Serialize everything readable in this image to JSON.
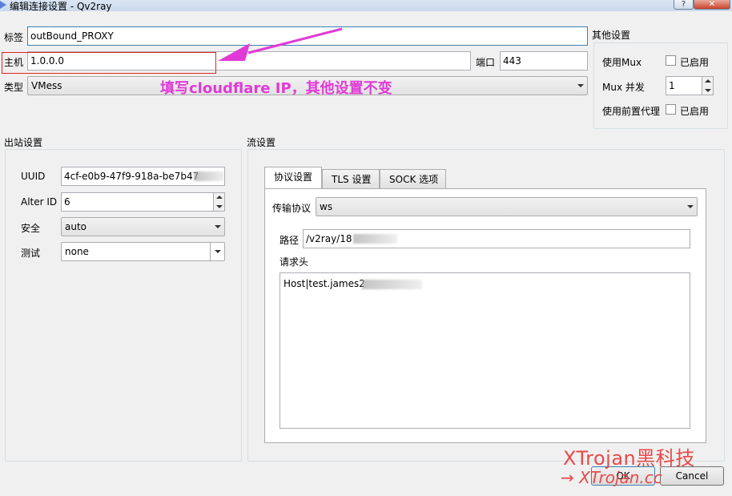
{
  "window": {
    "title": "编辑连接设置 - Qv2ray",
    "help_label": "?",
    "close_label": "✕"
  },
  "top": {
    "tag_label": "标签",
    "tag_value": "outBound_PROXY",
    "host_label": "主机",
    "host_value": "1.0.0.0",
    "port_label": "端口",
    "port_value": "443",
    "type_label": "类型",
    "type_value": "VMess"
  },
  "other_settings": {
    "title": "其他设置",
    "mux_label": "使用Mux",
    "mux_check_label": "已启用",
    "mux_concurrency_label": "Mux 并发",
    "mux_concurrency_value": "1",
    "proxy_label": "使用前置代理",
    "proxy_check_label": "已启用"
  },
  "outbound": {
    "title": "出站设置",
    "uuid_label": "UUID",
    "uuid_value": "4cf-e0b9-47f9-918a-be7b47",
    "alterid_label": "Alter ID",
    "alterid_value": "6",
    "security_label": "安全",
    "security_value": "auto",
    "test_label": "测试",
    "test_value": "none"
  },
  "stream": {
    "title": "流设置",
    "tabs": [
      {
        "label": "协议设置"
      },
      {
        "label": "TLS 设置"
      },
      {
        "label": "SOCK 选项"
      }
    ],
    "transport_label": "传输协议",
    "transport_value": "ws",
    "path_label": "路径",
    "path_value": "/v2ray/18",
    "headers_label": "请求头",
    "headers_value": "Host|test.james2"
  },
  "annotation": {
    "text": "填写cloudflare IP，其他设置不变",
    "color": "#e03ad6"
  },
  "buttons": {
    "ok_label": "OK",
    "cancel_label": "Cancel"
  },
  "watermark": {
    "line1": "XTrojan黑科技",
    "line2": "→  XTrojan.cc"
  }
}
